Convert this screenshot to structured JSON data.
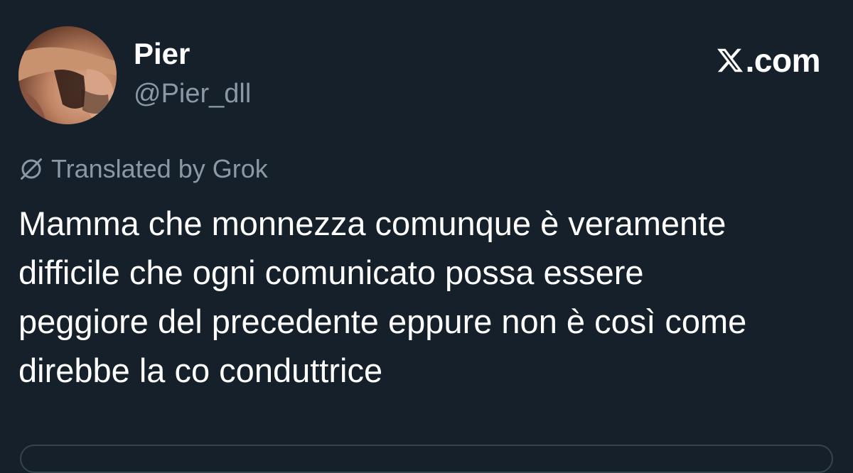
{
  "author": {
    "display_name": "Pier",
    "handle": "@Pier_dll",
    "avatar_icon": "profile-photo"
  },
  "brand": {
    "logo_icon": "x-logo-icon",
    "text": ".com"
  },
  "translation": {
    "icon": "grok-icon",
    "label": "Translated by Grok"
  },
  "tweet": {
    "text": "Mamma che monnezza comunque è veramente\ndifficile che ogni comunicato possa essere\npeggiore del precedente eppure non è così come\ndirebbe la co conduttrice"
  },
  "colors": {
    "background": "#15202b",
    "primary_text": "#ffffff",
    "secondary_text": "#8b98a5",
    "border": "#38444d"
  }
}
